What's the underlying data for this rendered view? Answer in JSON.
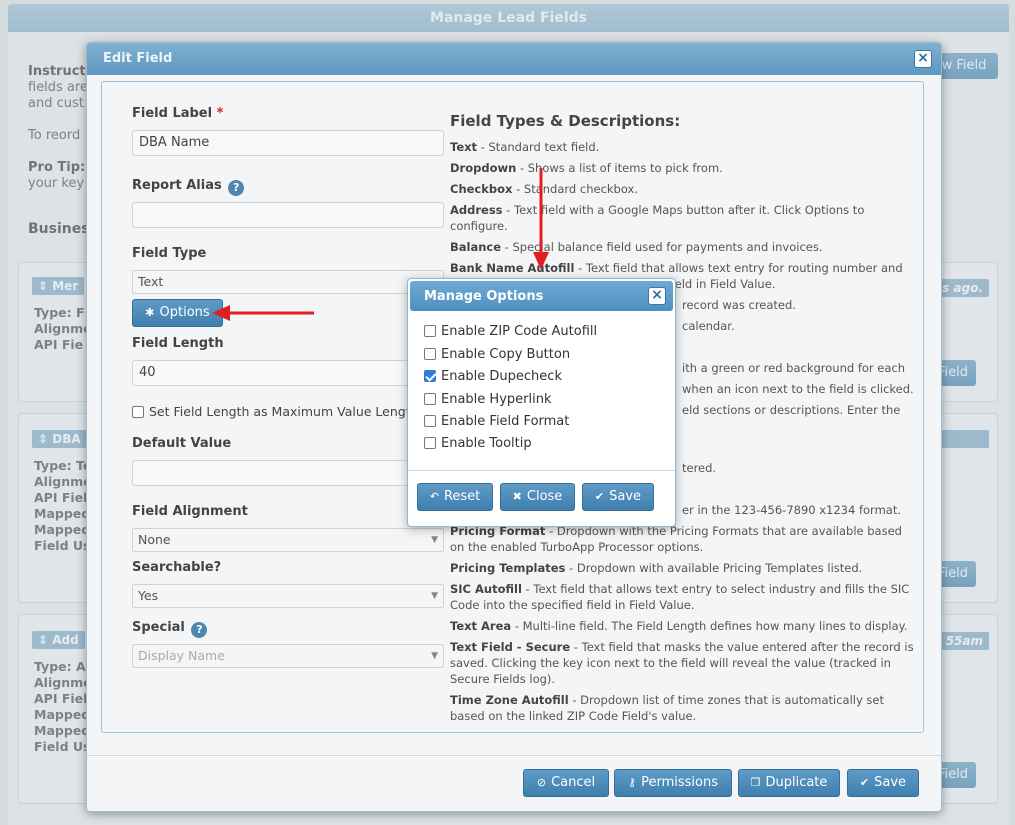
{
  "page": {
    "title": "Manage Lead Fields",
    "instr_prefix": "Instruct",
    "instr_line2": "fields are",
    "instr_line3": "and cust",
    "reorder": "To reord",
    "protip_label": "Pro Tip:",
    "protip_line2": "your key",
    "section_label": "Busines",
    "new_field_btn": "w Field",
    "cards": [
      {
        "header": "Mer",
        "right_header": "s ago.",
        "lines": [
          "Type: F",
          "Alignme",
          "API Fie"
        ],
        "btn": "Field"
      },
      {
        "header": "DBA",
        "right_header": "",
        "lines": [
          "Type: Te",
          "Alignme",
          "API Fiel",
          "Mapped",
          "Mapped",
          "Field Us"
        ],
        "btn": "Field"
      },
      {
        "header": "Add",
        "right_header": "55am",
        "lines": [
          "Type: A",
          "Alignme",
          "API Fiel",
          "Mapped",
          "Mapped",
          "Field Us"
        ],
        "btn": "Field"
      }
    ]
  },
  "edit_field": {
    "title": "Edit Field",
    "field_label": "Field Label",
    "required_mark": "*",
    "field_label_value": "DBA Name",
    "report_alias": "Report Alias",
    "report_alias_value": "",
    "field_type": "Field Type",
    "field_type_value": "Text",
    "options_btn": "Options",
    "field_length": "Field Length",
    "field_length_value": "40",
    "set_max_label": "Set Field Length as Maximum Value Length",
    "default_value": "Default Value",
    "default_value_value": "",
    "field_alignment": "Field Alignment",
    "field_alignment_value": "None",
    "searchable": "Searchable?",
    "searchable_value": "Yes",
    "special": "Special",
    "special_value": "Display Name",
    "types_title": "Field Types & Descriptions:",
    "types": [
      {
        "name": "Text",
        "desc": " - Standard text field."
      },
      {
        "name": "Dropdown",
        "desc": " - Shows a list of items to pick from."
      },
      {
        "name": "Checkbox",
        "desc": " - Standard checkbox."
      },
      {
        "name": "Address",
        "desc": " - Text field with a Google Maps button after it. Click Options to configure."
      },
      {
        "name": "Balance",
        "desc": " - Special balance field used for payments and invoices."
      },
      {
        "name": "Bank Name Autofill",
        "desc": " - Text field that allows text entry for routing number and fills the bank name into the specified field in Field Value."
      },
      {
        "name": "",
        "desc": "record was created."
      },
      {
        "name": "",
        "desc": "calendar."
      },
      {
        "name": "",
        "desc": ""
      },
      {
        "name": "",
        "desc": "ith a green or red background for each"
      },
      {
        "name": "",
        "desc": "when an icon next to the field is clicked."
      },
      {
        "name": "",
        "desc": "eld sections or descriptions. Enter the text"
      },
      {
        "name": "",
        "desc": ""
      },
      {
        "name": "",
        "desc": "tered."
      },
      {
        "name": "",
        "desc": ""
      },
      {
        "name": "",
        "desc": "er in the 123-456-7890 x1234 format."
      },
      {
        "name": "Pricing Format",
        "desc": " - Dropdown with the Pricing Formats that are available based on the enabled TurboApp Processor options."
      },
      {
        "name": "Pricing Templates",
        "desc": " - Dropdown with available Pricing Templates listed."
      },
      {
        "name": "SIC Autofill",
        "desc": " - Text field that allows text entry to select industry and fills the SIC Code into the specified field in Field Value."
      },
      {
        "name": "Text Area",
        "desc": " - Multi-line field. The Field Length defines how many lines to display."
      },
      {
        "name": "Text Field - Secure",
        "desc": " - Text field that masks the value entered after the record is saved. Clicking the key icon next to the field will reveal the value (tracked in Secure Fields log)."
      },
      {
        "name": "Time Zone Autofill",
        "desc": " - Dropdown list of time zones that is automatically set based on the linked ZIP Code Field's value."
      }
    ],
    "footer": {
      "cancel": "Cancel",
      "permissions": "Permissions",
      "duplicate": "Duplicate",
      "save": "Save"
    }
  },
  "manage_options": {
    "title": "Manage Options",
    "options": [
      {
        "label": "Enable ZIP Code Autofill",
        "checked": false
      },
      {
        "label": "Enable Copy Button",
        "checked": false
      },
      {
        "label": "Enable Dupecheck",
        "checked": true
      },
      {
        "label": "Enable Hyperlink",
        "checked": false
      },
      {
        "label": "Enable Field Format",
        "checked": false
      },
      {
        "label": "Enable Tooltip",
        "checked": false
      }
    ],
    "reset": "Reset",
    "close": "Close",
    "save": "Save"
  },
  "colors": {
    "accent": "#4f8fc0",
    "arrow": "#e02020"
  }
}
